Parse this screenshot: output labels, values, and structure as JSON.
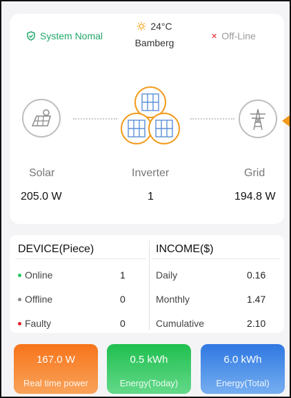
{
  "status": {
    "system": "System Nomal",
    "connection": "Off-Line",
    "temperature": "24°C",
    "location": "Bamberg"
  },
  "flow": {
    "solar_label": "Solar",
    "solar_value": "205.0 W",
    "inverter_label": "Inverter",
    "inverter_value": "1",
    "grid_label": "Grid",
    "grid_value": "194.8 W"
  },
  "device": {
    "title": "DEVICE(Piece)",
    "items": [
      {
        "label": "Online",
        "value": "1",
        "color": "#22c55e"
      },
      {
        "label": "Offline",
        "value": "0",
        "color": "#888888"
      },
      {
        "label": "Faulty",
        "value": "0",
        "color": "#e11d2a"
      }
    ]
  },
  "income": {
    "title": "INCOME($)",
    "items": [
      {
        "label": "Daily",
        "value": "0.16"
      },
      {
        "label": "Monthly",
        "value": "1.47"
      },
      {
        "label": "Cumulative",
        "value": "2.10"
      }
    ]
  },
  "tiles": [
    {
      "value": "167.0 W",
      "label": "Real time power",
      "color": "#f6841f"
    },
    {
      "value": "0.5 kWh",
      "label": "Energy(Today)",
      "color": "#2fc35c"
    },
    {
      "value": "6.0 kWh",
      "label": "Energy(Total)",
      "color": "#3a86e6"
    }
  ]
}
